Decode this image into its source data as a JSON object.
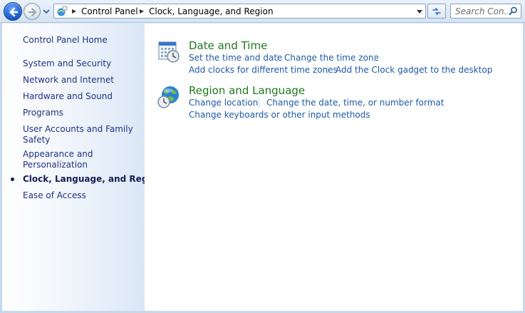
{
  "address_bar": {
    "breadcrumbs": [
      "Control Panel",
      "Clock, Language, and Region"
    ],
    "search_placeholder": "Search Con..."
  },
  "left_pane": {
    "items": [
      {
        "label": "Control Panel Home",
        "current": false
      },
      {
        "label": "System and Security",
        "current": false
      },
      {
        "label": "Network and Internet",
        "current": false
      },
      {
        "label": "Hardware and Sound",
        "current": false
      },
      {
        "label": "Programs",
        "current": false
      },
      {
        "label": "User Accounts and Family",
        "label2": "Safety",
        "current": false
      },
      {
        "label": "Appearance and",
        "label2": "Personalization",
        "current": false
      },
      {
        "label": "Clock, Language, and Region",
        "current": true
      },
      {
        "label": "Ease of Access",
        "current": false
      }
    ]
  },
  "categories": [
    {
      "title": "Date and Time",
      "icon": "calendar-clock-icon",
      "tasks": [
        "Set the time and date",
        "Change the time zone",
        "Add clocks for different time zones",
        "Add the Clock gadget to the desktop"
      ]
    },
    {
      "title": "Region and Language",
      "icon": "globe-clock-icon",
      "tasks": [
        "Change location",
        "Change the date, time, or number format",
        "Change keyboards or other input methods"
      ]
    }
  ],
  "colors": {
    "category_title": "#1d7a1d",
    "task_link": "#1e5aa8",
    "nav_link": "#1e3287"
  }
}
